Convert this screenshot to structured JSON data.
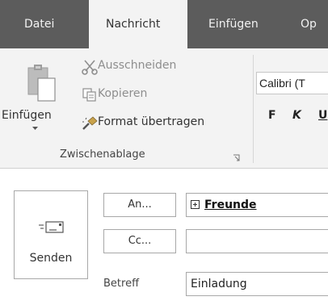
{
  "tabs": [
    {
      "label": "Datei",
      "active": false
    },
    {
      "label": "Nachricht",
      "active": true
    },
    {
      "label": "Einfügen",
      "active": false
    },
    {
      "label": "Op",
      "active": false
    }
  ],
  "ribbon": {
    "clipboard": {
      "paste_label": "Einfügen",
      "cut_label": "Ausschneiden",
      "copy_label": "Kopieren",
      "format_painter_label": "Format übertragen",
      "group_label": "Zwischenablage"
    },
    "font": {
      "font_name": "Calibri (T",
      "bold_label": "F",
      "italic_label": "K",
      "underline_label": "U"
    }
  },
  "compose": {
    "send_label": "Senden",
    "to_button_label": "An...",
    "cc_button_label": "Cc...",
    "subject_label": "Betreff",
    "to_value": "Freunde",
    "cc_value": "",
    "subject_value": "Einladung"
  },
  "colors": {
    "tabbar_bg": "#5c5c5c",
    "ribbon_bg": "#f3f3f3",
    "disabled_text": "#8e8e8e"
  },
  "icons": [
    "paste-icon",
    "cut-icon",
    "copy-icon",
    "format-painter-icon",
    "dialog-launcher-icon",
    "send-envelope-icon",
    "expand-group-icon",
    "dropdown-arrow-icon"
  ]
}
